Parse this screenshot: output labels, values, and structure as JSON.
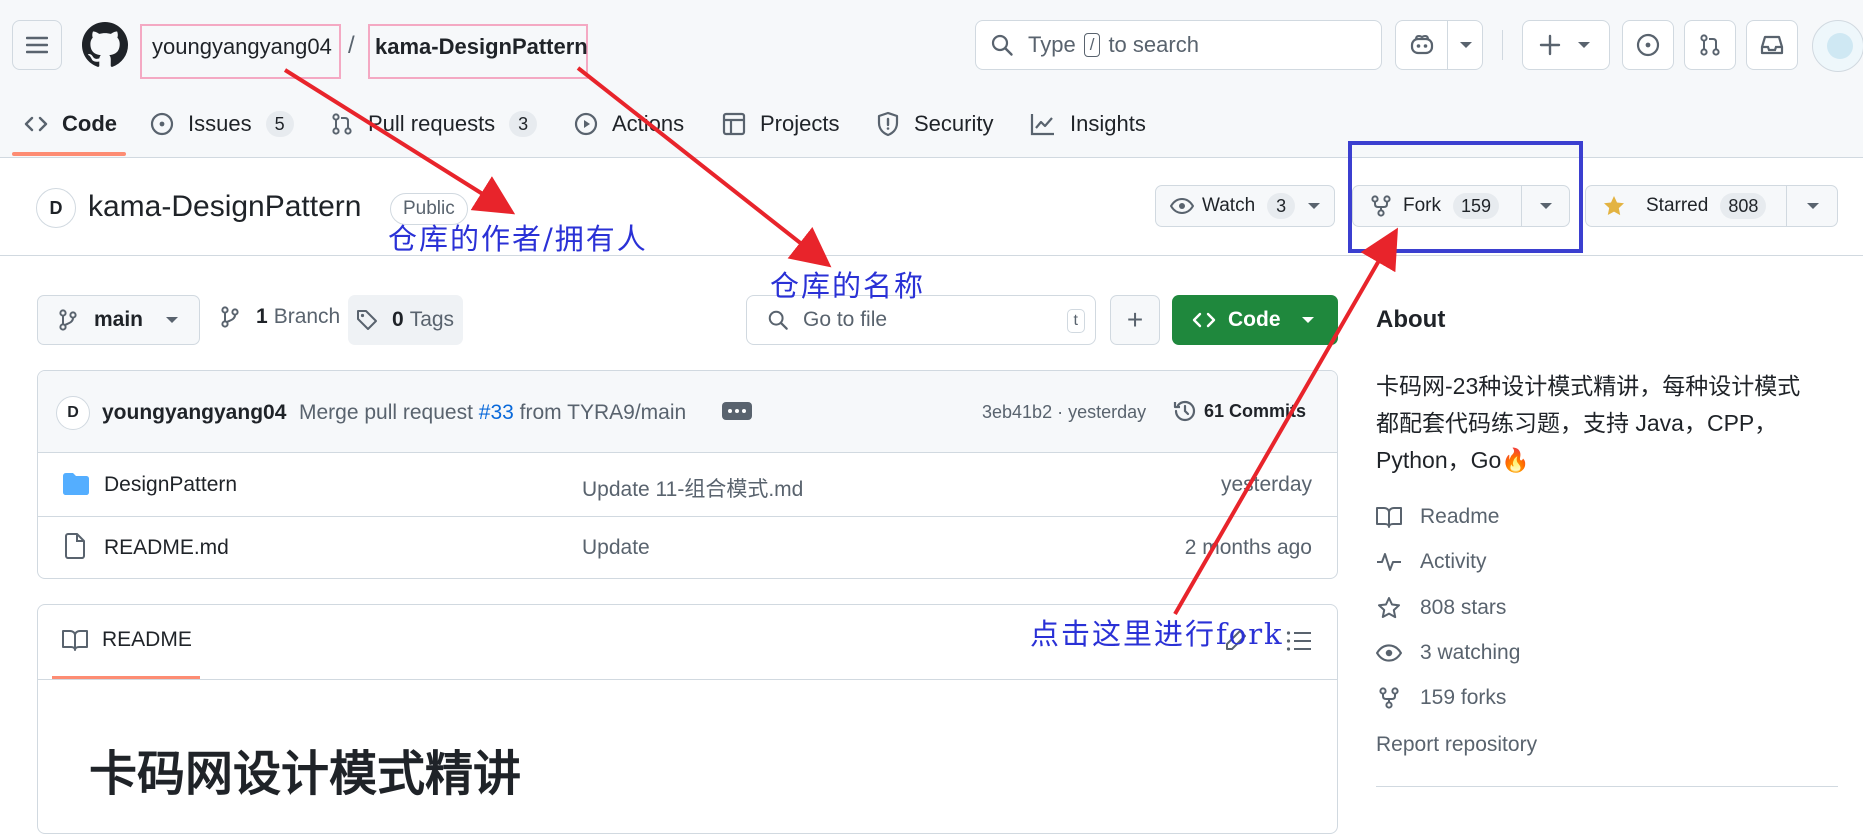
{
  "header": {
    "owner": "youngyangyang04",
    "separator": "/",
    "repo": "kama-DesignPattern",
    "search_placeholder_pre": "Type",
    "search_key": "/",
    "search_placeholder_post": "to search"
  },
  "tabs": [
    {
      "label": "Code"
    },
    {
      "label": "Issues",
      "count": "5"
    },
    {
      "label": "Pull requests",
      "count": "3"
    },
    {
      "label": "Actions"
    },
    {
      "label": "Projects"
    },
    {
      "label": "Security"
    },
    {
      "label": "Insights"
    }
  ],
  "repo_header": {
    "name": "kama-DesignPattern",
    "visibility": "Public",
    "watch_label": "Watch",
    "watch_count": "3",
    "fork_label": "Fork",
    "fork_count": "159",
    "star_label": "Starred",
    "star_count": "808"
  },
  "toolbar": {
    "branch": "main",
    "branch_count": "1",
    "branch_label": "Branch",
    "tag_count": "0",
    "tag_label": "Tags",
    "goto_placeholder": "Go to file",
    "goto_key": "t",
    "add_label": "+",
    "code_label": "Code"
  },
  "commit": {
    "author": "youngyangyang04",
    "message_pre": "Merge pull request",
    "pr": "#33",
    "message_post": "from TYRA9/main",
    "hash_time": "3eb41b2 · yesterday",
    "commits": "61 Commits"
  },
  "files": [
    {
      "name": "DesignPattern",
      "message": "Update 11-组合模式.md",
      "time": "yesterday",
      "type": "folder"
    },
    {
      "name": "README.md",
      "message": "Update",
      "time": "2 months ago",
      "type": "file"
    }
  ],
  "readme": {
    "tab_label": "README",
    "heading": "卡码网设计模式精讲"
  },
  "about": {
    "title": "About",
    "description_line1": "卡码网-23种设计模式精讲，每种设计模式",
    "description_line2": "都配套代码练习题，支持 Java，CPP，",
    "description_line3": "Python，Go🔥",
    "readme": "Readme",
    "activity": "Activity",
    "stars": "808 stars",
    "watching": "3 watching",
    "forks": "159 forks",
    "report": "Report repository"
  },
  "annotations": {
    "owner_note": "仓库的作者/拥有人",
    "name_note": "仓库的名称",
    "fork_note": "点击这里进行fork",
    "arrow_color": "#e8242b",
    "box_color": "#3b3fd0",
    "highlight_color": "#f4a9c3"
  },
  "colors": {
    "accent": "#fd8c73",
    "green": "#1f883d",
    "link": "#0969da"
  }
}
